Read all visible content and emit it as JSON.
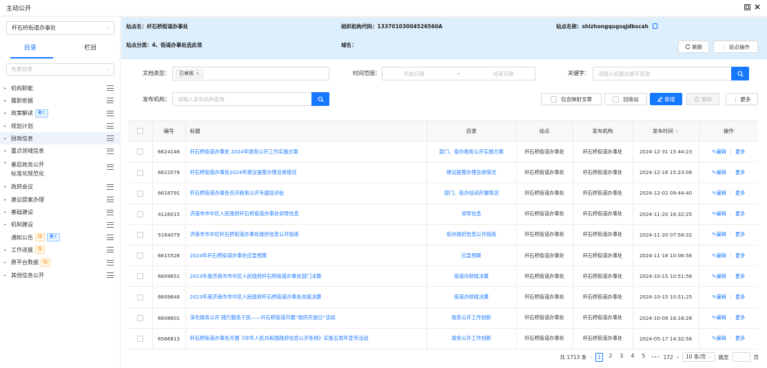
{
  "window": {
    "title": "主动公开"
  },
  "sidebar": {
    "site_select": "杆石桥街道办事处",
    "tabs": {
      "catalog": "目录",
      "column": "栏目"
    },
    "dir_search_placeholder": "检索目录",
    "items": [
      {
        "label": "机构职能",
        "tags": []
      },
      {
        "label": "履职依据",
        "tags": []
      },
      {
        "label": "政策解读",
        "tags": [
          {
            "text": "聚↑",
            "type": "b"
          }
        ]
      },
      {
        "label": "规划计划",
        "tags": []
      },
      {
        "label": "财政信息",
        "tags": [],
        "highlight": true
      },
      {
        "label": "重点领域信息",
        "tags": []
      },
      {
        "label": "基层政务公开标准化规范化",
        "tags": [],
        "two_line": [
          "基层政务公开",
          "标准化规范化"
        ]
      },
      {
        "label": "政府会议",
        "tags": []
      },
      {
        "label": "建议提案办理",
        "tags": []
      },
      {
        "label": "基础建设",
        "tags": []
      },
      {
        "label": "机制建设",
        "tags": []
      },
      {
        "label": "通知公告",
        "tags": [
          {
            "text": "隐",
            "type": "o"
          },
          {
            "text": "聚↑",
            "type": "b"
          }
        ],
        "no_caret": true
      },
      {
        "label": "工作进展",
        "tags": [
          {
            "text": "隐",
            "type": "o"
          }
        ]
      },
      {
        "label": "原平台数据",
        "tags": [
          {
            "text": "隐",
            "type": "o"
          }
        ]
      },
      {
        "label": "其他信息公开",
        "tags": []
      }
    ]
  },
  "info": {
    "site_name_label": "站点名：",
    "site_name": "杆石桥街道办事处",
    "org_code_label": "组织机构代码：",
    "org_code": "13370103004526560A",
    "site_title_label": "站点名称：",
    "site_title": "shizhongqugsqjdbscah",
    "category_label": "站点分类：",
    "category": "4、街道办事处选此项",
    "domain_label": "域名：",
    "domain": "",
    "refresh": "刷新",
    "site_ops": "站点操作"
  },
  "filters": {
    "doc_type_label": "文档类型：",
    "doc_type_chip": "已审核",
    "time_label": "时间范围：",
    "start_placeholder": "开始日期",
    "end_placeholder": "结束日期",
    "range_sep": "~",
    "keyword_label": "关键字：",
    "keyword_placeholder": "请输入标题关键字查询",
    "publisher_label": "发布机构：",
    "publisher_placeholder": "请输入发布机构查询",
    "include_mapped": "包含映射文章",
    "recycle": "回收站",
    "add": "新增",
    "delete": "删除",
    "more": "更多"
  },
  "table": {
    "headers": {
      "id": "编号",
      "title": "标题",
      "catalog": "目录",
      "site": "站点",
      "publisher": "发布机构",
      "date": "发布时间",
      "ops": "操作"
    },
    "edit": "编辑",
    "more": "更多",
    "rows": [
      {
        "id": "6624146",
        "title": "杆石桥街道办事处 2024年政务公开工作实施方案",
        "catalog": "部门、街办政务公开实施方案",
        "site": "杆石桥街道办事处",
        "publisher": "杆石桥街道办事处",
        "date": "2024-12-31 15:44:23"
      },
      {
        "id": "6622078",
        "title": "杆石桥街道办事处2024年建议提案办理总体情况",
        "catalog": "建议提案办理总体情况",
        "site": "杆石桥街道办事处",
        "publisher": "杆石桥街道办事处",
        "date": "2024-12-16 15:23:08"
      },
      {
        "id": "6618791",
        "title": "杆石桥街道办事处召开政务公开专题培训会",
        "catalog": "部门、街办培训开展情况",
        "site": "杆石桥街道办事处",
        "publisher": "杆石桥街道办事处",
        "date": "2024-12-02 09:44:40"
      },
      {
        "id": "4126015",
        "title": "济南市市中区人民政府杆石桥街道办事处领导信息",
        "catalog": "领导信息",
        "site": "杆石桥街道办事处",
        "publisher": "杆石桥街道办事处",
        "date": "2024-11-20 16:32:25"
      },
      {
        "id": "5184079",
        "title": "济南市市中区杆石桥街道办事处政府信息公开指南",
        "catalog": "街办政府信息公开指南",
        "site": "杆石桥街道办事处",
        "publisher": "杆石桥街道办事处",
        "date": "2024-11-20 07:58:32"
      },
      {
        "id": "6615528",
        "title": "2024年杆石桥街道办事处应急预案",
        "catalog": "应急预案",
        "site": "杆石桥街道办事处",
        "publisher": "杆石桥街道办事处",
        "date": "2024-11-18 10:06:56"
      },
      {
        "id": "6609651",
        "title": "2023年度济南市市中区人民政府杆石桥街道办事处部门决算",
        "catalog": "街道办财政决算",
        "site": "杆石桥街道办事处",
        "publisher": "杆石桥街道办事处",
        "date": "2024-10-15 10:51:56"
      },
      {
        "id": "6609648",
        "title": "2023年度济南市市中区人民政府杆石桥街道办事处本级决算",
        "catalog": "街道办财政决算",
        "site": "杆石桥街道办事处",
        "publisher": "杆石桥街道办事处",
        "date": "2024-10-15 10:51:25"
      },
      {
        "id": "6608601",
        "title": "深化政务公开 践行服务于民——杆石桥街道开展“政府开放日”活动",
        "catalog": "政务公开工作创新",
        "site": "杆石桥街道办事处",
        "publisher": "杆石桥街道办事处",
        "date": "2024-10-09 18:18:28"
      },
      {
        "id": "6566813",
        "title": "杆石桥街道办事处开展《中华人民共和国政府信息公开条例》实施五周年宣传活动",
        "catalog": "政务公开工作创新",
        "site": "杆石桥街道办事处",
        "publisher": "杆石桥街道办事处",
        "date": "2024-05-17 14:32:56"
      }
    ]
  },
  "pagination": {
    "total": "共 1713 条",
    "pages": [
      "1",
      "2",
      "3",
      "4",
      "5"
    ],
    "ellipsis": "•••",
    "last": "172",
    "per_page": "10 条/页",
    "goto_label": "跳至",
    "page_unit": "页"
  }
}
